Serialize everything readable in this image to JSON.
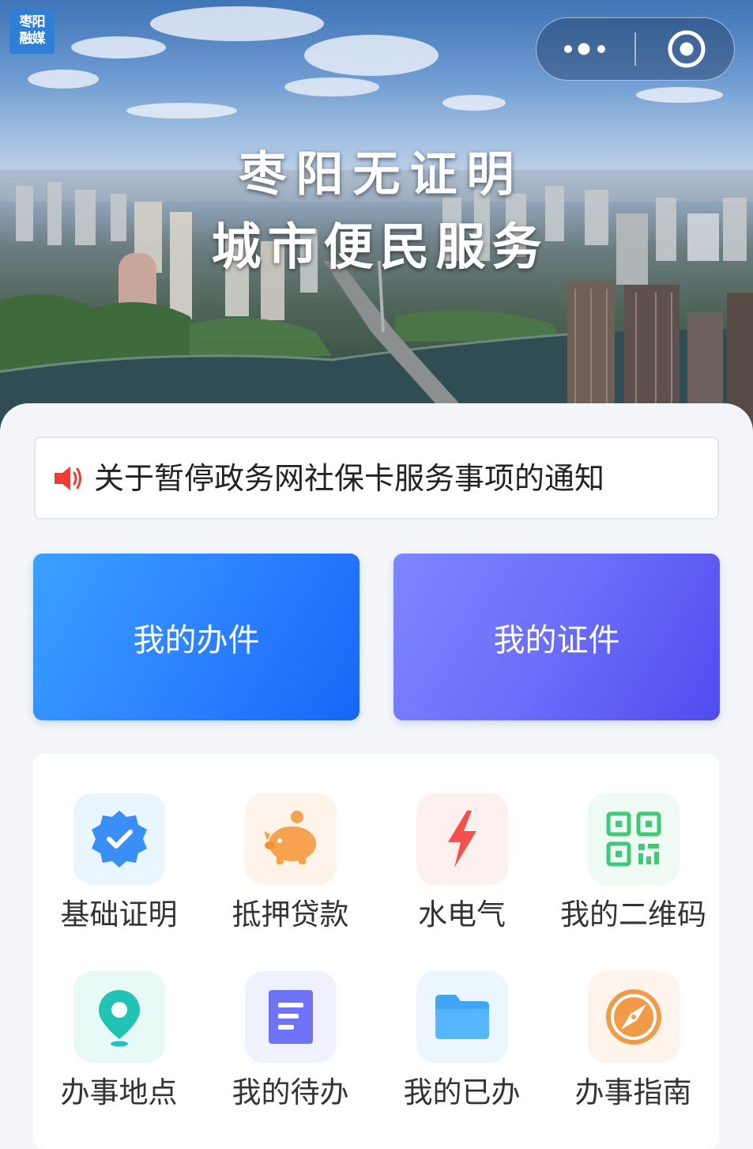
{
  "badge": {
    "line1": "枣阳",
    "line2": "融媒"
  },
  "capsule": {
    "more_icon": "more-dots-icon",
    "close_icon": "target-circle-icon"
  },
  "hero": {
    "title_line1": "枣阳无证明",
    "title_line2": "城市便民服务"
  },
  "notice": {
    "icon": "speaker-icon",
    "text": "关于暂停政务网社保卡服务事项的通知"
  },
  "primary_buttons": [
    {
      "label": "我的办件"
    },
    {
      "label": "我的证件"
    }
  ],
  "services": [
    {
      "label": "基础证明",
      "icon": "verified-badge-icon",
      "tint": "#e9f5ff",
      "color": "#3a8ff7"
    },
    {
      "label": "抵押贷款",
      "icon": "piggy-bank-icon",
      "tint": "#fff3ea",
      "color": "#f7a24e"
    },
    {
      "label": "水电气",
      "icon": "lightning-icon",
      "tint": "#fff0f0",
      "color": "#f4514d"
    },
    {
      "label": "我的二维码",
      "icon": "qr-code-icon",
      "tint": "#eefaf3",
      "color": "#3fca78"
    },
    {
      "label": "办事地点",
      "icon": "location-pin-icon",
      "tint": "#e8faf6",
      "color": "#21c4b4"
    },
    {
      "label": "我的待办",
      "icon": "document-icon",
      "tint": "#f0f1ff",
      "color": "#6f74f6"
    },
    {
      "label": "我的已办",
      "icon": "folder-icon",
      "tint": "#ebf6ff",
      "color": "#41a5f5"
    },
    {
      "label": "办事指南",
      "icon": "compass-icon",
      "tint": "#fff4ec",
      "color": "#f39a48"
    }
  ]
}
